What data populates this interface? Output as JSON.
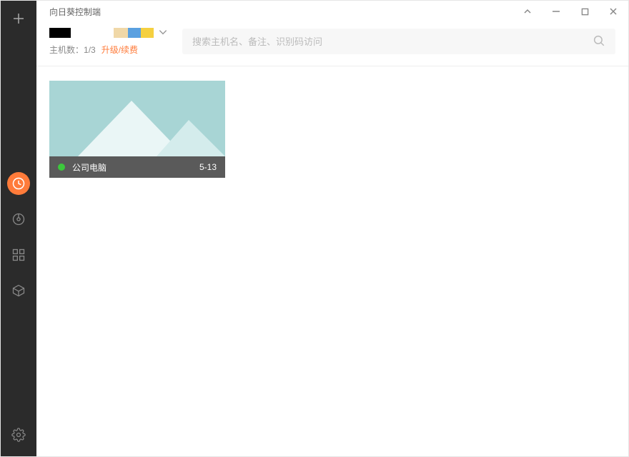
{
  "window": {
    "title": "向日葵控制端"
  },
  "sidebar": {
    "icons": {
      "add": "plus-icon",
      "recent": "clock-icon",
      "discover": "radar-icon",
      "apps": "grid-icon",
      "box": "cube-icon",
      "settings": "gear-icon"
    }
  },
  "account": {
    "host_count_label": "主机数：",
    "host_count_value": "1/3",
    "upgrade_label": "升级/续费"
  },
  "search": {
    "placeholder": "搜索主机名、备注、识别码访问"
  },
  "hosts": [
    {
      "name": "公司电脑",
      "date": "5-13",
      "status": "online"
    }
  ],
  "colors": {
    "accent": "#ff7b3a",
    "sidebar_bg": "#2b2b2b",
    "online": "#3cc83c"
  }
}
